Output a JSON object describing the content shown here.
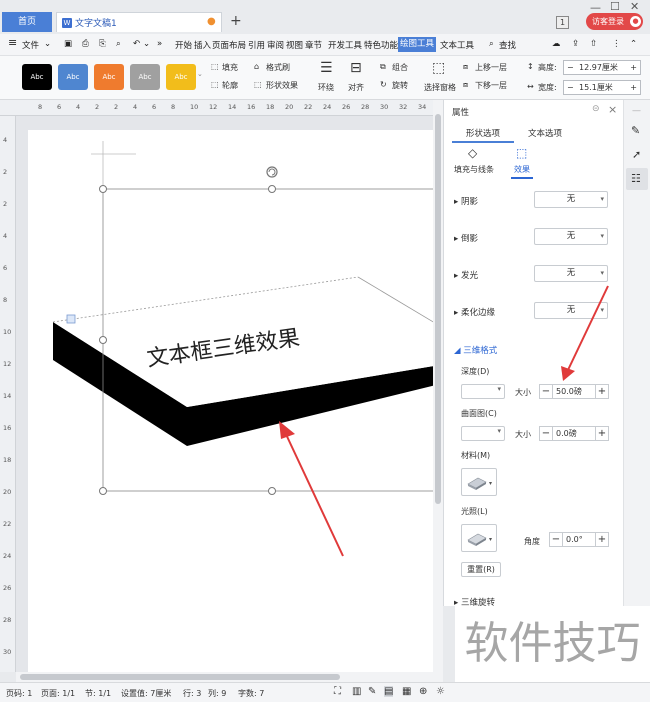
{
  "title_bar": {
    "home_tab": "首页",
    "doc_tab": "文字文稿1",
    "badge": "1",
    "login": "访客登录"
  },
  "menu": {
    "file": "文件",
    "items": [
      "开始",
      "插入",
      "页面布局",
      "引用",
      "审阅",
      "视图",
      "章节",
      "开发工具",
      "特色功能"
    ],
    "active": "绘图工具",
    "text_tool": "文本工具",
    "search": "查找"
  },
  "ribbon": {
    "swatch_label": "Abc",
    "swatch_colors": [
      "#000000",
      "#4f86d0",
      "#ef7b2e",
      "#a0a0a0",
      "#f2bd1b"
    ],
    "fill": "填充",
    "format_brush": "格式刷",
    "outline": "轮廓",
    "shape_effect": "形状效果",
    "wrap": "环绕",
    "align": "对齐",
    "group": "组合",
    "rotate": "旋转",
    "selection_pane": "选择窗格",
    "bring_forward": "上移一层",
    "send_backward": "下移一层",
    "height_label": "高度:",
    "height_value": "12.97厘米",
    "width_label": "宽度:",
    "width_value": "15.1厘米"
  },
  "ruler": {
    "h_ticks": [
      "8",
      "6",
      "4",
      "2",
      "2",
      "4",
      "6",
      "8",
      "10",
      "12",
      "14",
      "16",
      "18",
      "20",
      "22",
      "24",
      "26",
      "28",
      "30",
      "32",
      "34"
    ],
    "v_ticks": [
      "4",
      "2",
      "2",
      "4",
      "6",
      "8",
      "10",
      "12",
      "14",
      "16",
      "18",
      "20",
      "22",
      "24",
      "26",
      "28",
      "30"
    ]
  },
  "document": {
    "text3d": "文本框三维效果"
  },
  "panel": {
    "title": "属性",
    "tab_shape": "形状选项",
    "tab_text": "文本选项",
    "sub_fill": "填充与线条",
    "sub_effect": "效果",
    "shadow": "阴影",
    "reflection": "倒影",
    "glow": "发光",
    "soft_edge": "柔化边缘",
    "none": "无",
    "format3d": "三维格式",
    "depth": "深度(D)",
    "size": "大小",
    "depth_value": "50.0磅",
    "contour": "曲面图(C)",
    "contour_value": "0.0磅",
    "material": "材料(M)",
    "lighting": "光照(L)",
    "angle": "角度",
    "angle_value": "0.0°",
    "reset": "重置(R)",
    "rotation3d": "三维旋转"
  },
  "status": {
    "page_num": "页码: 1",
    "pages": "页面: 1/1",
    "section": "节: 1/1",
    "setting": "设置值: 7厘米",
    "row": "行: 3",
    "col": "列: 9",
    "words": "字数: 7"
  },
  "watermark": "软件技巧"
}
